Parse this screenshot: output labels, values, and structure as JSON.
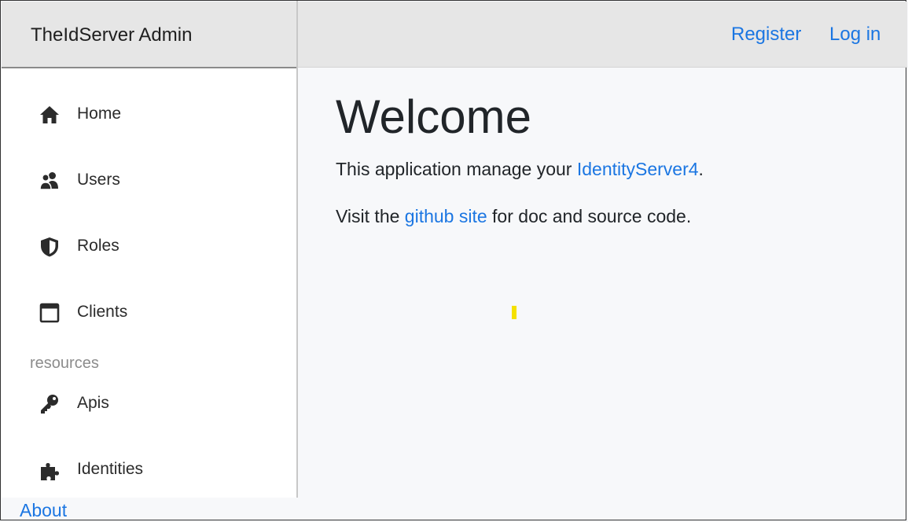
{
  "header": {
    "brand": "TheIdServer Admin",
    "register_label": "Register",
    "login_label": "Log in"
  },
  "sidebar": {
    "items": [
      {
        "label": "Home",
        "icon": "home-icon"
      },
      {
        "label": "Users",
        "icon": "users-icon"
      },
      {
        "label": "Roles",
        "icon": "shield-icon"
      },
      {
        "label": "Clients",
        "icon": "window-icon"
      }
    ],
    "section_label": "resources",
    "resource_items": [
      {
        "label": "Apis",
        "icon": "key-icon"
      },
      {
        "label": "Identities",
        "icon": "puzzle-icon"
      }
    ],
    "about_label": "About"
  },
  "main": {
    "title": "Welcome",
    "line1_prefix": "This application manage your ",
    "line1_link": "IdentityServer4",
    "line1_suffix": ".",
    "line2_prefix": "Visit the ",
    "line2_link": "github site",
    "line2_suffix": " for doc and source code."
  },
  "colors": {
    "link": "#1b76e2",
    "header_bg": "#e6e6e6",
    "main_bg": "#f7f8fa",
    "caret": "#f5e100"
  }
}
